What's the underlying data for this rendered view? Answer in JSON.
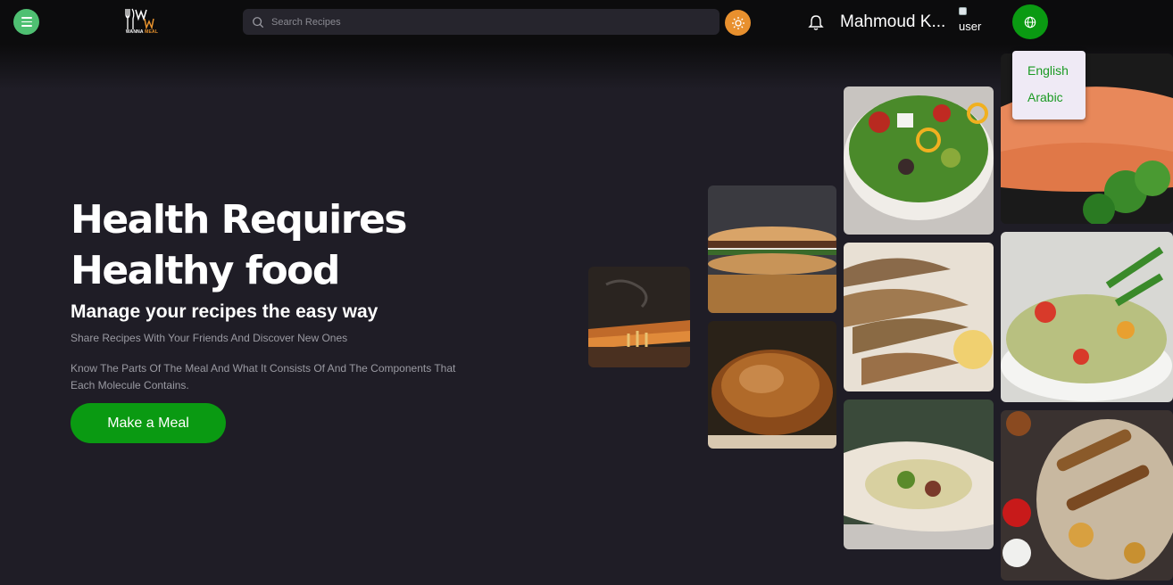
{
  "header": {
    "logo_text_main": "WANNA",
    "logo_text_accent": "MEAL",
    "search_placeholder": "Search Recipes",
    "username": "Mahmoud K...",
    "avatar_alt": "user"
  },
  "language_menu": {
    "items": [
      "English",
      "Arabic"
    ]
  },
  "hero": {
    "title_line1": "Health Requires",
    "title_line2": "Healthy food",
    "subtitle": "Manage your recipes the easy way",
    "description1": "Share Recipes With Your Friends And Discover New Ones",
    "description2": "Know The Parts Of The Meal And What It Consists Of And The Components That Each Molecule Contains.",
    "cta_label": "Make a Meal"
  },
  "gallery": {
    "images": [
      "pizza",
      "sandwich",
      "roast-chicken",
      "salad",
      "fried-fish",
      "shawarma-wrap",
      "salmon",
      "pasta-salad",
      "grilled-platter"
    ]
  },
  "colors": {
    "accent_green": "#0a9a12",
    "menu_green": "#4fc072",
    "theme_orange": "#e8902e",
    "background": "#1f1d26"
  }
}
